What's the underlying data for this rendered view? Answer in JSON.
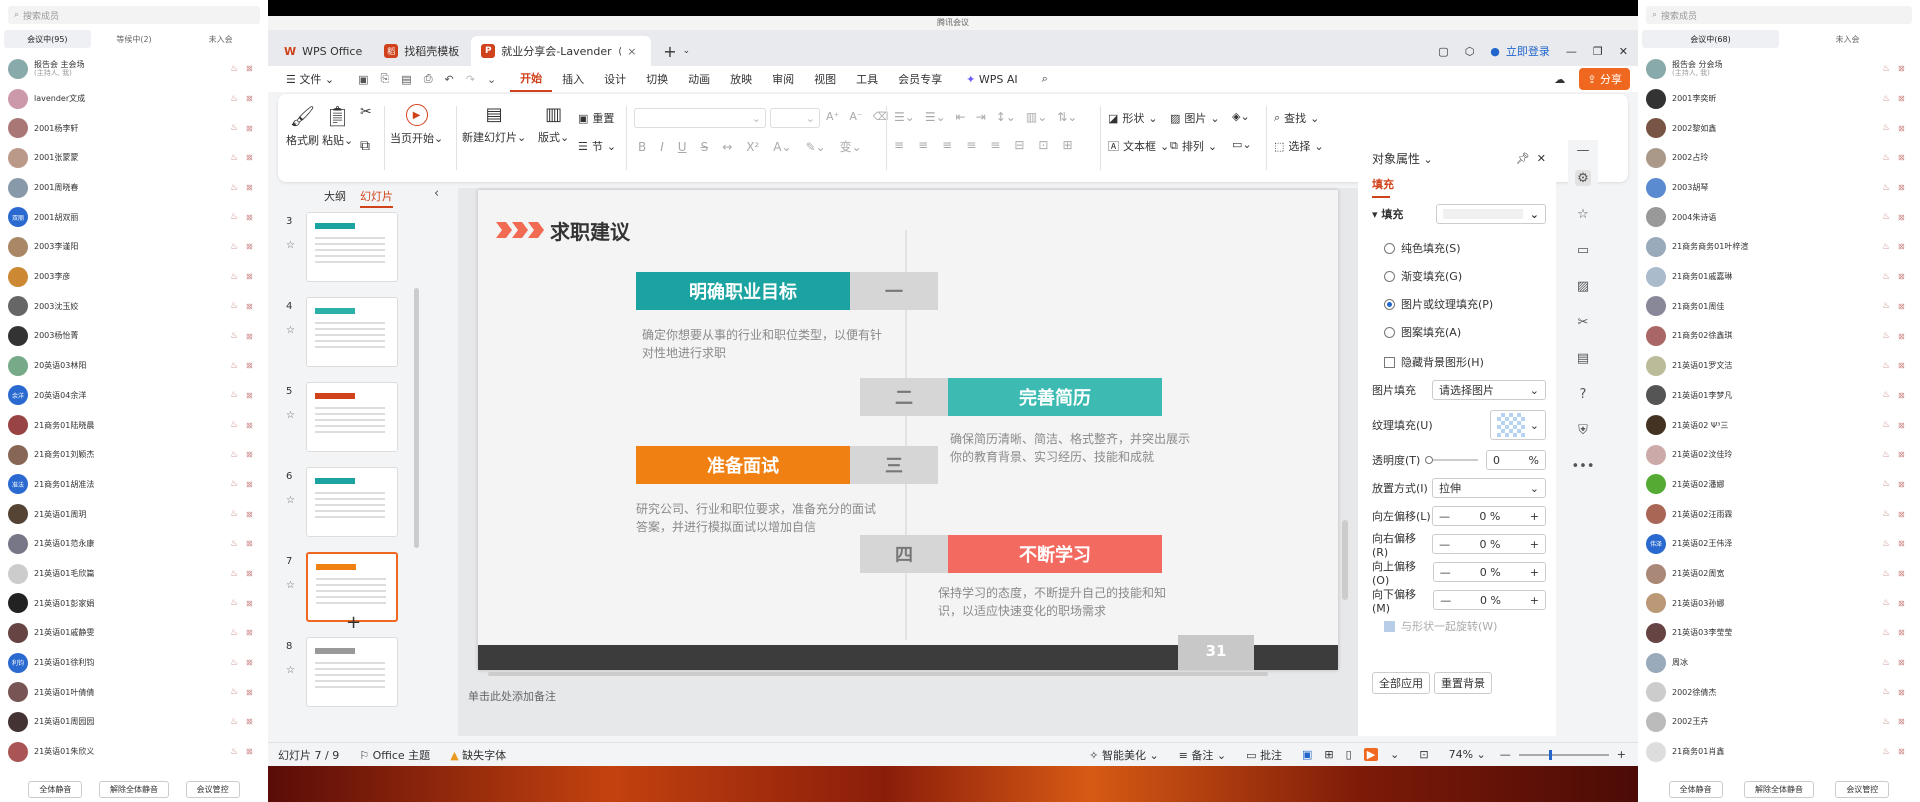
{
  "meeting_title": "腾讯会议",
  "left_panel": {
    "search_placeholder": "搜索成员",
    "tabs": [
      "会议中(95)",
      "等候中(2)",
      "未入会"
    ],
    "members": [
      {
        "name": "报告会 主会场",
        "sub": "(主持人, 我)",
        "color": "#8aa"
      },
      {
        "name": "lavender文成",
        "sub": "",
        "color": "#c9a"
      },
      {
        "name": "2001杨李轩",
        "sub": "",
        "color": "#a77"
      },
      {
        "name": "2001张蒙蒙",
        "sub": "",
        "color": "#b98"
      },
      {
        "name": "2001周晓春",
        "sub": "",
        "color": "#89a"
      },
      {
        "name": "2001胡双丽",
        "sub": "",
        "color": "#2a6ad0",
        "initials": "双丽"
      },
      {
        "name": "2003李谨阳",
        "sub": "",
        "color": "#a86"
      },
      {
        "name": "2003李彦",
        "sub": "",
        "color": "#c83"
      },
      {
        "name": "2003沈玉姣",
        "sub": "",
        "color": "#666"
      },
      {
        "name": "2003杨怡菁",
        "sub": "",
        "color": "#333"
      },
      {
        "name": "20英语03林阳",
        "sub": "",
        "color": "#7a8"
      },
      {
        "name": "20英语04余洋",
        "sub": "",
        "color": "#2a6ad0",
        "initials": "余洋"
      },
      {
        "name": "21商务01陆晓晨",
        "sub": "",
        "color": "#944"
      },
      {
        "name": "21商务01刘颖杰",
        "sub": "",
        "color": "#865"
      },
      {
        "name": "21商务01胡准法",
        "sub": "",
        "color": "#2a6ad0",
        "initials": "准法"
      },
      {
        "name": "21英语01周玥",
        "sub": "",
        "color": "#543"
      },
      {
        "name": "21英语01范永康",
        "sub": "",
        "color": "#778"
      },
      {
        "name": "21英语01毛欣篇",
        "sub": "",
        "color": "#ccc"
      },
      {
        "name": "21英语01彭家娟",
        "sub": "",
        "color": "#222"
      },
      {
        "name": "21英语01戚静雯",
        "sub": "",
        "color": "#644"
      },
      {
        "name": "21英语01徐利钧",
        "sub": "",
        "color": "#2a6ad0",
        "initials": "利钧"
      },
      {
        "name": "21英语01叶倩倩",
        "sub": "",
        "color": "#755"
      },
      {
        "name": "21英语01周园园",
        "sub": "",
        "color": "#433"
      },
      {
        "name": "21英语01朱欣义",
        "sub": "",
        "color": "#a55"
      }
    ],
    "buttons": [
      "全体静音",
      "解除全体静音",
      "会议管控"
    ]
  },
  "right_panel": {
    "search_placeholder": "搜索成员",
    "tabs": [
      "会议中(68)",
      "未入会"
    ],
    "members": [
      {
        "name": "报告会 分会场",
        "sub": "(主持人, 我)",
        "color": "#8aa"
      },
      {
        "name": "2001李奕昕",
        "sub": "",
        "color": "#333"
      },
      {
        "name": "2002黎如鑫",
        "sub": "",
        "color": "#754"
      },
      {
        "name": "2002占玲",
        "sub": "",
        "color": "#a98"
      },
      {
        "name": "2003胡琴",
        "sub": "",
        "color": "#5a8ad0"
      },
      {
        "name": "2004朱诗语",
        "sub": "",
        "color": "#999"
      },
      {
        "name": "21商务商务01叶梓渲",
        "sub": "",
        "color": "#9ab"
      },
      {
        "name": "21商务01戚嘉琳",
        "sub": "",
        "color": "#abc"
      },
      {
        "name": "21商务01周佳",
        "sub": "",
        "color": "#889"
      },
      {
        "name": "21商务02徐鑫琪",
        "sub": "",
        "color": "#a66"
      },
      {
        "name": "21英语01罗文洁",
        "sub": "",
        "color": "#bb9"
      },
      {
        "name": "21英语01李梦凡",
        "sub": "",
        "color": "#555"
      },
      {
        "name": "21英语02 Ψ³三",
        "sub": "",
        "color": "#432"
      },
      {
        "name": "21英语02汶佳玲",
        "sub": "",
        "color": "#caa"
      },
      {
        "name": "21英语02潘娜",
        "sub": "",
        "color": "#5a3"
      },
      {
        "name": "21英语02汪雨霖",
        "sub": "",
        "color": "#a65"
      },
      {
        "name": "21英语02王伟泽",
        "sub": "",
        "color": "#2a6ad0",
        "initials": "伟泽"
      },
      {
        "name": "21英语02周宽",
        "sub": "",
        "color": "#a87"
      },
      {
        "name": "21英语03孙娜",
        "sub": "",
        "color": "#b97"
      },
      {
        "name": "21英语03李莹莹",
        "sub": "",
        "color": "#644"
      },
      {
        "name": "周冰",
        "sub": "",
        "color": "#9ab"
      },
      {
        "name": "2002徐倩杰",
        "sub": "",
        "color": "#ccc"
      },
      {
        "name": "2002王卉",
        "sub": "",
        "color": "#bbb"
      },
      {
        "name": "21商务01肖鑫",
        "sub": "",
        "color": "#ddd"
      }
    ],
    "buttons": [
      "全体静音",
      "解除全体静音",
      "会议管控"
    ]
  },
  "wps": {
    "tabs": [
      {
        "label": "WPS Office",
        "icon": "W",
        "color": "#d0421b"
      },
      {
        "label": "找稻壳模板",
        "icon": "稻",
        "color": "#d0421b"
      },
      {
        "label": "就业分享会-Lavender（罗文洁）",
        "icon": "P",
        "color": "#d0421b"
      }
    ],
    "login": "立即登录",
    "menu_file": "文件",
    "menus": [
      "开始",
      "插入",
      "设计",
      "切换",
      "动画",
      "放映",
      "审阅",
      "视图",
      "工具",
      "会员专享"
    ],
    "wps_ai": "WPS AI",
    "share": "分享",
    "ribbon": {
      "format_painter": "格式刷",
      "paste": "粘贴",
      "from_current": "当页开始",
      "new_slide": "新建幻灯片",
      "layout": "版式",
      "reset": "重置",
      "section": "节",
      "shape": "形状",
      "picture": "图片",
      "textbox": "文本框",
      "arrange": "排列",
      "find": "查找",
      "select": "选择"
    },
    "outline_tabs": [
      "大纲",
      "幻灯片"
    ],
    "thumb_numbers": [
      "3",
      "4",
      "5",
      "6",
      "7",
      "8"
    ],
    "notes_placeholder": "单击此处添加备注",
    "status": {
      "slide": "幻灯片 7 / 9",
      "theme": "Office 主题",
      "missing_font": "缺失字体",
      "beautify": "智能美化",
      "notes": "备注",
      "comments": "批注",
      "zoom": "74%"
    }
  },
  "slide": {
    "title": "求职建议",
    "page_number": "31",
    "items": [
      {
        "label": "明确职业目标",
        "num": "一",
        "desc": "确定你想要从事的行业和职位类型，以便有针对性地进行求职",
        "color": "#1aa3a1"
      },
      {
        "label": "完善简历",
        "num": "二",
        "desc": "确保简历清晰、简洁、格式整齐，并突出展示你的教育背景、实习经历、技能和成就",
        "color": "#3dbbb3"
      },
      {
        "label": "准备面试",
        "num": "三",
        "desc": "研究公司、行业和职位要求，准备充分的面试答案，并进行模拟面试以增加自信",
        "color": "#f08012"
      },
      {
        "label": "不断学习",
        "num": "四",
        "desc": "保持学习的态度，不断提升自己的技能和知识，以适应快速变化的职场需求",
        "color": "#f36b60"
      }
    ]
  },
  "props": {
    "title": "对象属性",
    "tab": "填充",
    "fill_label": "填充",
    "options": [
      "纯色填充(S)",
      "渐变填充(G)",
      "图片或纹理填充(P)",
      "图案填充(A)"
    ],
    "selected_option": 2,
    "hide_bg": "隐藏背景图形(H)",
    "picture_fill": "图片填充",
    "picture_fill_value": "请选择图片",
    "texture_fill": "纹理填充(U)",
    "transparency": "透明度(T)",
    "transparency_value": "0",
    "transparency_unit": "%",
    "placement": "放置方式(I)",
    "placement_value": "拉伸",
    "offsets": [
      {
        "label": "向左偏移(L)",
        "value": "0",
        "unit": "%"
      },
      {
        "label": "向右偏移(R)",
        "value": "0",
        "unit": "%"
      },
      {
        "label": "向上偏移(O)",
        "value": "0",
        "unit": "%"
      },
      {
        "label": "向下偏移(M)",
        "value": "0",
        "unit": "%"
      }
    ],
    "rotate_with_shape": "与形状一起旋转(W)",
    "apply_all": "全部应用",
    "reset_bg": "重置背景"
  }
}
